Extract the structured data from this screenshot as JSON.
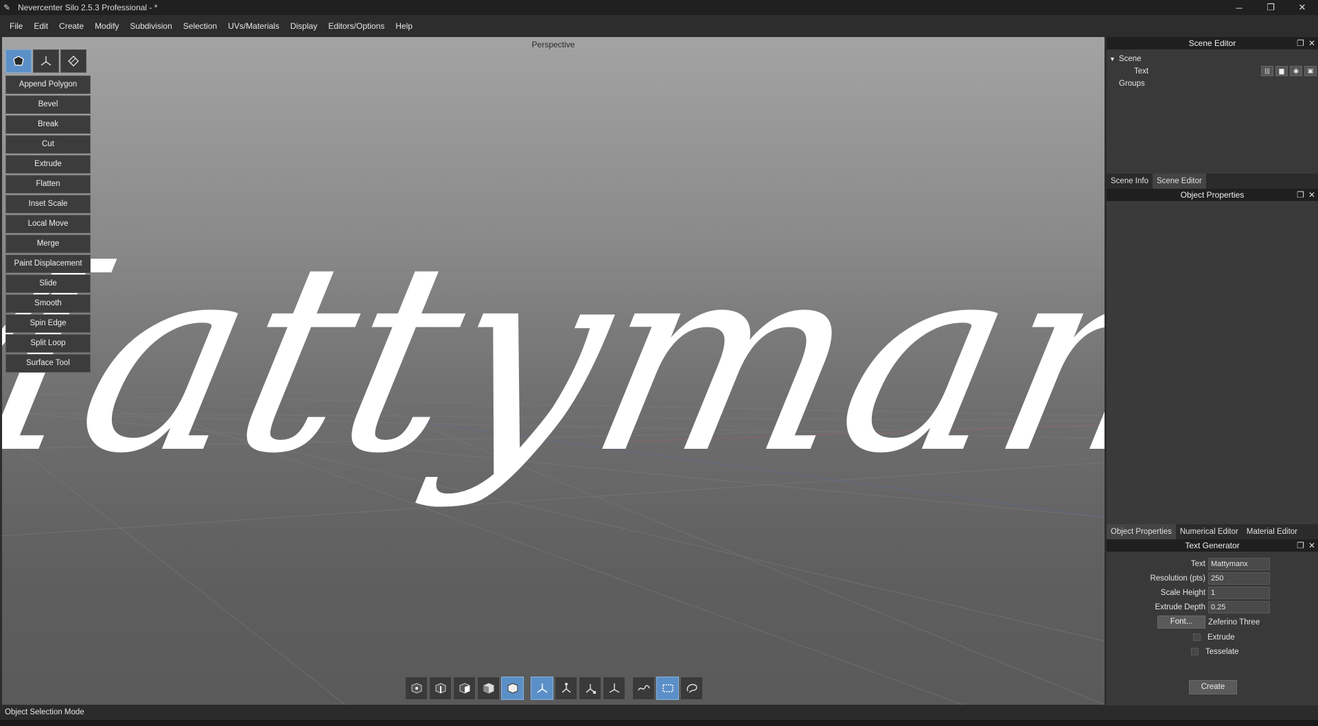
{
  "window": {
    "title": "Nevercenter Silo 2.5.3 Professional - *",
    "minimize": "─",
    "restore": "❐",
    "close": "✕"
  },
  "menu": [
    "File",
    "Edit",
    "Create",
    "Modify",
    "Subdivision",
    "Selection",
    "UVs/Materials",
    "Display",
    "Editors/Options",
    "Help"
  ],
  "viewport": {
    "label": "Perspective",
    "model_text": "Mattymanx"
  },
  "tools": [
    "Append Polygon",
    "Bevel",
    "Break",
    "Cut",
    "Extrude",
    "Flatten",
    "Inset Scale",
    "Local Move",
    "Merge",
    "Paint Displacement",
    "Slide",
    "Smooth",
    "Spin Edge",
    "Split Loop",
    "Surface Tool"
  ],
  "scene_editor": {
    "header": "Scene Editor",
    "tree": {
      "scene": "Scene",
      "text_object": "Text",
      "groups": "Groups"
    },
    "tabs": [
      "Scene Info",
      "Scene Editor"
    ]
  },
  "object_properties": {
    "header": "Object Properties",
    "tabs": [
      "Object Properties",
      "Numerical Editor",
      "Material Editor"
    ]
  },
  "text_generator": {
    "header": "Text Generator",
    "text_label": "Text",
    "text_value": "Mattymanx",
    "resolution_label": "Resolution (pts)",
    "resolution_value": "250",
    "scale_height_label": "Scale Height",
    "scale_height_value": "1",
    "extrude_depth_label": "Extrude Depth",
    "extrude_depth_value": "0.25",
    "font_button": "Font...",
    "font_name": "Zeferino Three",
    "extrude_label": "Extrude",
    "tesselate_label": "Tesselate",
    "create_button": "Create"
  },
  "status": {
    "mode": "Object Selection Mode"
  },
  "colors": {
    "accent": "#5b8fc7",
    "panel_bg": "#393939",
    "header_bg": "#1f1f1f"
  }
}
